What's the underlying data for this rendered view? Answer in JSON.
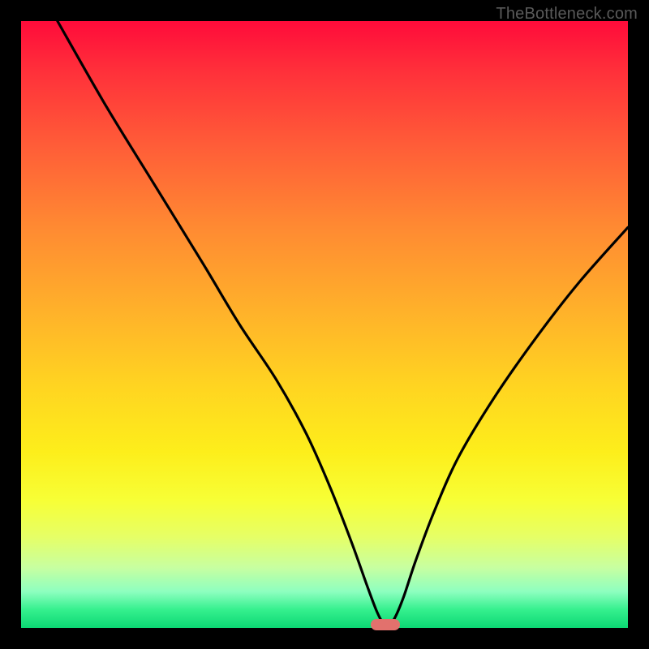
{
  "watermark": "TheBottleneck.com",
  "chart_data": {
    "type": "line",
    "title": "",
    "xlabel": "",
    "ylabel": "",
    "xlim": [
      0,
      100
    ],
    "ylim": [
      0,
      100
    ],
    "grid": false,
    "legend": false,
    "series": [
      {
        "name": "curve",
        "color": "#000000",
        "x": [
          6,
          14,
          22,
          30,
          36,
          42,
          47,
          51,
          54.5,
          57,
          58.5,
          59.5,
          60.3,
          61.5,
          63,
          65,
          68,
          72,
          78,
          85,
          92,
          100
        ],
        "y": [
          100,
          86,
          73,
          60,
          50,
          41,
          32,
          23,
          14,
          7,
          3,
          1,
          0.3,
          1.5,
          5,
          11,
          19,
          28,
          38,
          48,
          57,
          66
        ]
      }
    ],
    "marker": {
      "x": 60,
      "y": 0.6,
      "color": "#e2716d"
    },
    "background_gradient": {
      "top": "#ff0b3a",
      "mid": "#ffe01f",
      "bottom": "#0cd873"
    }
  }
}
